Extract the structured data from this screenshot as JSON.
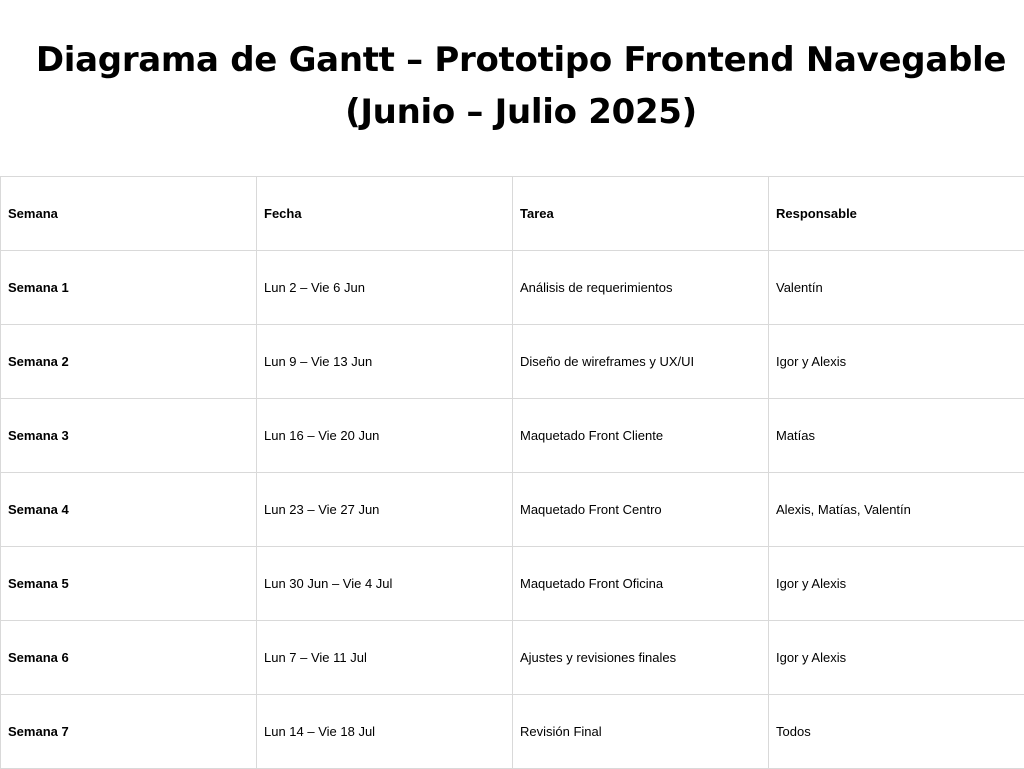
{
  "document": {
    "title_line1": "Diagrama de Gantt – Prototipo Frontend Navegable",
    "title_line2": "(Junio – Julio 2025)"
  },
  "table": {
    "headers": [
      "Semana",
      "Fecha",
      "Tarea",
      "Responsable"
    ],
    "rows": [
      {
        "semana": "Semana 1",
        "fecha": "Lun 2 – Vie 6 Jun",
        "tarea": "Análisis de requerimientos",
        "responsable": "Valentín"
      },
      {
        "semana": "Semana 2",
        "fecha": "Lun 9 – Vie 13 Jun",
        "tarea": "Diseño de wireframes y UX/UI",
        "responsable": "Igor y Alexis"
      },
      {
        "semana": "Semana 3",
        "fecha": "Lun 16 – Vie 20 Jun",
        "tarea": "Maquetado Front Cliente",
        "responsable": "Matías"
      },
      {
        "semana": "Semana 4",
        "fecha": "Lun 23 – Vie 27 Jun",
        "tarea": "Maquetado Front Centro",
        "responsable": "Alexis, Matías, Valentín"
      },
      {
        "semana": "Semana 5",
        "fecha": "Lun 30 Jun – Vie 4 Jul",
        "tarea": "Maquetado Front Oficina",
        "responsable": "Igor y Alexis"
      },
      {
        "semana": "Semana 6",
        "fecha": "Lun 7 – Vie 11 Jul",
        "tarea": "Ajustes y revisiones finales",
        "responsable": "Igor y Alexis"
      },
      {
        "semana": "Semana 7",
        "fecha": "Lun 14 – Vie 18 Jul",
        "tarea": "Revisión Final",
        "responsable": "Todos"
      }
    ]
  }
}
